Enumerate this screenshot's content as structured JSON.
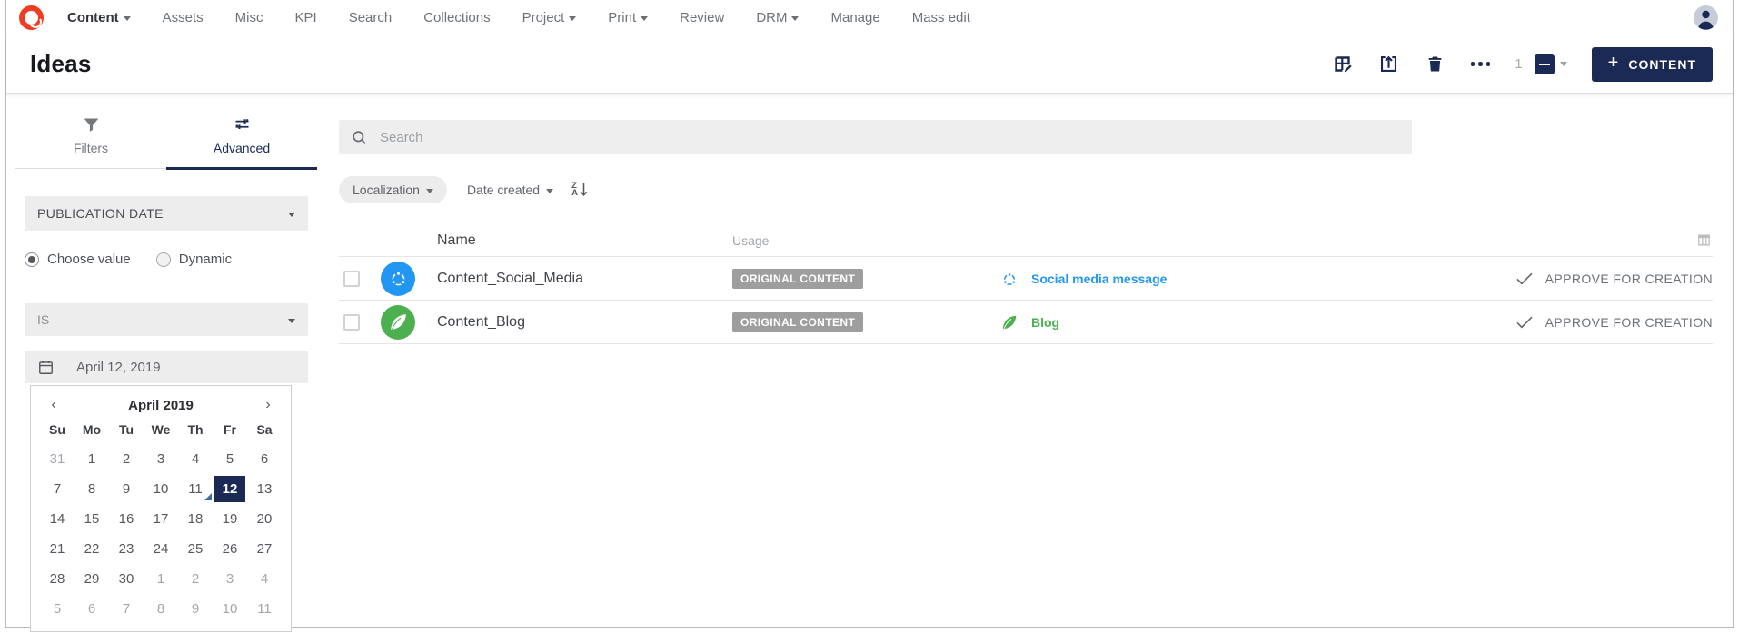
{
  "colors": {
    "navy": "#1b2a55",
    "blue": "#2196f3",
    "green": "#4caf50",
    "badge_gray": "#9e9e9e"
  },
  "nav": {
    "items": [
      {
        "label": "Content",
        "caret": true,
        "active": true
      },
      {
        "label": "Assets"
      },
      {
        "label": "Misc"
      },
      {
        "label": "KPI"
      },
      {
        "label": "Search"
      },
      {
        "label": "Collections"
      },
      {
        "label": "Project",
        "caret": true
      },
      {
        "label": "Print",
        "caret": true
      },
      {
        "label": "Review"
      },
      {
        "label": "DRM",
        "caret": true
      },
      {
        "label": "Manage"
      },
      {
        "label": "Mass edit"
      }
    ]
  },
  "header": {
    "title": "Ideas",
    "selection_count": "1",
    "content_button": "CONTENT"
  },
  "sidebar": {
    "tabs": [
      {
        "label": "Filters",
        "icon": "filter-icon"
      },
      {
        "label": "Advanced",
        "icon": "tune-icon",
        "active": true
      }
    ],
    "publication_date": {
      "title": "PUBLICATION DATE",
      "radio_choose": "Choose value",
      "radio_dynamic": "Dynamic",
      "operator": "IS",
      "date_value": "April 12, 2019"
    },
    "calendar": {
      "month": "April 2019",
      "days": [
        "Su",
        "Mo",
        "Tu",
        "We",
        "Th",
        "Fr",
        "Sa"
      ],
      "cells": [
        {
          "d": "31",
          "muted": true
        },
        {
          "d": "1"
        },
        {
          "d": "2"
        },
        {
          "d": "3"
        },
        {
          "d": "4"
        },
        {
          "d": "5"
        },
        {
          "d": "6"
        },
        {
          "d": "7"
        },
        {
          "d": "8"
        },
        {
          "d": "9"
        },
        {
          "d": "10"
        },
        {
          "d": "11",
          "today": true
        },
        {
          "d": "12",
          "selected": true
        },
        {
          "d": "13"
        },
        {
          "d": "14"
        },
        {
          "d": "15"
        },
        {
          "d": "16"
        },
        {
          "d": "17"
        },
        {
          "d": "18"
        },
        {
          "d": "19"
        },
        {
          "d": "20"
        },
        {
          "d": "21"
        },
        {
          "d": "22"
        },
        {
          "d": "23"
        },
        {
          "d": "24"
        },
        {
          "d": "25"
        },
        {
          "d": "26"
        },
        {
          "d": "27"
        },
        {
          "d": "28"
        },
        {
          "d": "29"
        },
        {
          "d": "30"
        },
        {
          "d": "1",
          "muted": true
        },
        {
          "d": "2",
          "muted": true
        },
        {
          "d": "3",
          "muted": true
        },
        {
          "d": "4",
          "muted": true
        },
        {
          "d": "5",
          "muted": true
        },
        {
          "d": "6",
          "muted": true
        },
        {
          "d": "7",
          "muted": true
        },
        {
          "d": "8",
          "muted": true
        },
        {
          "d": "9",
          "muted": true
        },
        {
          "d": "10",
          "muted": true
        },
        {
          "d": "11",
          "muted": true
        }
      ]
    }
  },
  "main": {
    "search_placeholder": "Search",
    "filter_chip": "Localization",
    "sort_chip": "Date created",
    "table": {
      "col_name": "Name",
      "col_usage": "Usage",
      "rows": [
        {
          "name": "Content_Social_Media",
          "badge": "ORIGINAL CONTENT",
          "usage": "Social media message",
          "action": "APPROVE FOR CREATION",
          "icon": "share",
          "accent": "#2196f3"
        },
        {
          "name": "Content_Blog",
          "badge": "ORIGINAL CONTENT",
          "usage": "Blog",
          "action": "APPROVE FOR CREATION",
          "icon": "feather",
          "accent": "#4caf50"
        }
      ]
    }
  }
}
